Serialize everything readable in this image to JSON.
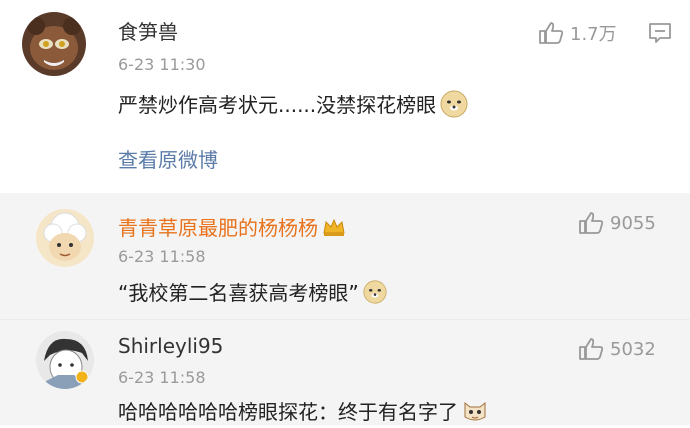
{
  "comment": {
    "username": "食笋兽",
    "time": "6-23 11:30",
    "text": "严禁炒作高考状元......没禁探花榜眼",
    "likes": "1.7万",
    "view_original": "查看原微博"
  },
  "replies": [
    {
      "username": "青青草原最肥的杨杨杨",
      "time": "6-23 11:58",
      "text": "“我校第二名喜获高考榜眼”",
      "likes": "9055"
    },
    {
      "username": "Shirleyli95",
      "time": "6-23 11:58",
      "text": "哈哈哈哈哈哈榜眼探花：终于有名字了",
      "likes": "5032"
    }
  ],
  "colors": {
    "reply_bg": "#f4f4f4",
    "link": "#5b7ba8",
    "vip_name": "#e8731c"
  }
}
